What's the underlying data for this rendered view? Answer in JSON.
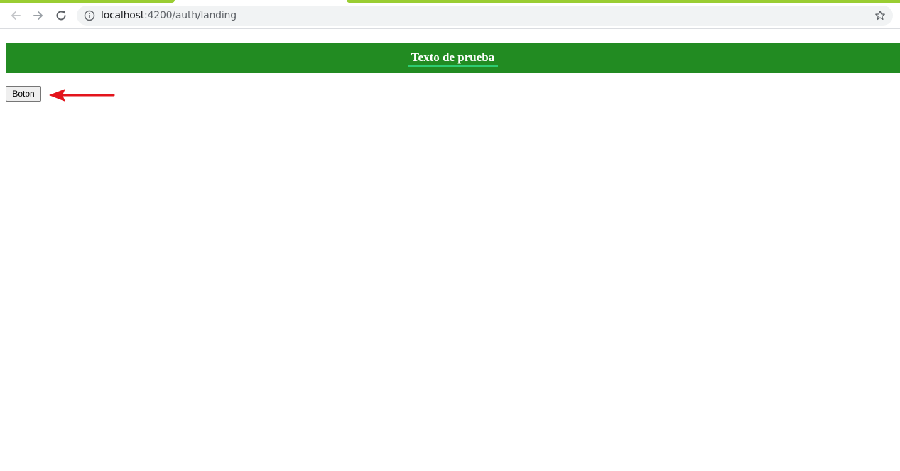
{
  "browser": {
    "url_host": "localhost",
    "url_path": ":4200/auth/landing",
    "icons": {
      "back": "arrow-left-icon",
      "forward": "arrow-right-icon",
      "reload": "reload-icon",
      "site_info": "info-icon",
      "bookmark": "star-icon"
    },
    "colors": {
      "tab_accent": "#9acd32"
    }
  },
  "page": {
    "banner": {
      "title": "Texto de prueba",
      "background": "#228b22",
      "underline": "#2ecc71"
    },
    "button_label": "Boton",
    "annotation": {
      "icon": "red-arrow-left-icon",
      "color": "#e3141c"
    }
  }
}
